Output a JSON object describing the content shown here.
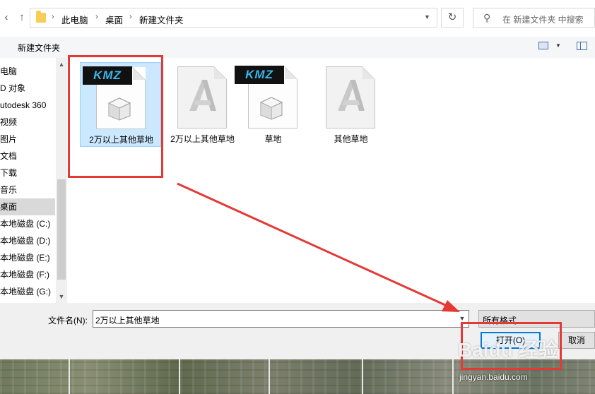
{
  "addressbar": {
    "breadcrumbs": [
      "此电脑",
      "桌面",
      "新建文件夹"
    ],
    "search_placeholder": "在 新建文件夹 中搜索"
  },
  "toolbar": {
    "new_folder": "新建文件夹"
  },
  "sidebar": {
    "items": [
      {
        "label": "电脑"
      },
      {
        "label": "D 对象"
      },
      {
        "label": "utodesk 360"
      },
      {
        "label": "视频"
      },
      {
        "label": "图片"
      },
      {
        "label": "文档"
      },
      {
        "label": "下载"
      },
      {
        "label": "音乐"
      },
      {
        "label": "桌面",
        "selected": true
      },
      {
        "label": "本地磁盘 (C:)"
      },
      {
        "label": "本地磁盘 (D:)"
      },
      {
        "label": "本地磁盘 (E:)"
      },
      {
        "label": "本地磁盘 (F:)"
      },
      {
        "label": "本地磁盘 (G:)"
      }
    ]
  },
  "files": [
    {
      "name": "2万以上其他草地",
      "type": "kmz",
      "badge": "KMZ",
      "selected": true
    },
    {
      "name": "2万以上其他草地",
      "type": "autocad"
    },
    {
      "name": "草地",
      "type": "kmz",
      "badge": "KMZ"
    },
    {
      "name": "其他草地",
      "type": "autocad"
    }
  ],
  "bottom": {
    "filename_label": "文件名(N):",
    "filename_value": "2万以上其他草地",
    "filter_value": "所有格式",
    "open_button": "打开(O)",
    "cancel_button": "取消"
  },
  "watermark": {
    "logo": "Baidu 经验",
    "url": "jingyan.baidu.com"
  },
  "colors": {
    "accent": "#0078d7",
    "selection": "#cce8ff",
    "annotation_red": "#e53935",
    "kmz_text": "#39b6e8"
  }
}
